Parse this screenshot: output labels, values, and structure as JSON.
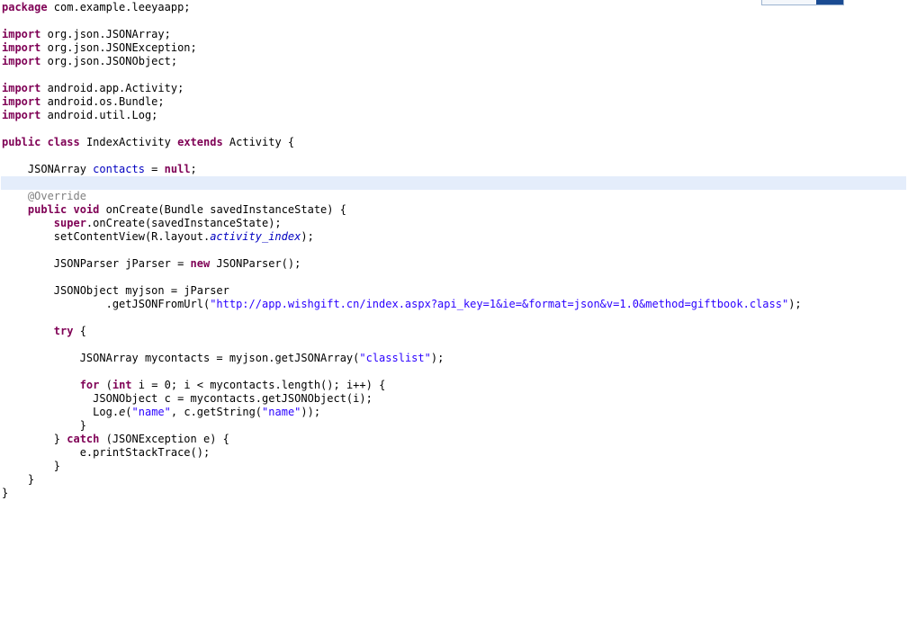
{
  "editor": {
    "language": "java",
    "font_size_px": 12,
    "line_height_px": 15,
    "highlight_line_index": 10,
    "colors": {
      "background": "#ffffff",
      "foreground": "#000000",
      "keyword": "#7f0055",
      "string": "#2a00ff",
      "field": "#0000c0",
      "annotation": "#808080",
      "current_line_highlight": "#e4edfb",
      "scrollbar_thumb": "#1a4b92"
    }
  },
  "scrollbar": {
    "name": "horizontal-scrollbar-fragment",
    "track_color": "#f4f7fb",
    "thumb_color": "#1a4b92"
  },
  "code": {
    "lines": [
      {
        "indent": 0,
        "tokens": [
          {
            "t": "kw",
            "v": "package"
          },
          {
            "t": "pln",
            "v": " com.example.leeyaapp;"
          }
        ]
      },
      {
        "indent": 0,
        "tokens": []
      },
      {
        "indent": 0,
        "tokens": [
          {
            "t": "kw",
            "v": "import"
          },
          {
            "t": "pln",
            "v": " org.json.JSONArray;"
          }
        ]
      },
      {
        "indent": 0,
        "tokens": [
          {
            "t": "kw",
            "v": "import"
          },
          {
            "t": "pln",
            "v": " org.json.JSONException;"
          }
        ]
      },
      {
        "indent": 0,
        "tokens": [
          {
            "t": "kw",
            "v": "import"
          },
          {
            "t": "pln",
            "v": " org.json.JSONObject;"
          }
        ]
      },
      {
        "indent": 0,
        "tokens": []
      },
      {
        "indent": 0,
        "tokens": [
          {
            "t": "kw",
            "v": "import"
          },
          {
            "t": "pln",
            "v": " android.app.Activity;"
          }
        ]
      },
      {
        "indent": 0,
        "tokens": [
          {
            "t": "kw",
            "v": "import"
          },
          {
            "t": "pln",
            "v": " android.os.Bundle;"
          }
        ]
      },
      {
        "indent": 0,
        "tokens": [
          {
            "t": "kw",
            "v": "import"
          },
          {
            "t": "pln",
            "v": " android.util.Log;"
          }
        ]
      },
      {
        "indent": 0,
        "tokens": []
      },
      {
        "indent": 0,
        "tokens": [
          {
            "t": "kw",
            "v": "public"
          },
          {
            "t": "pln",
            "v": " "
          },
          {
            "t": "kw",
            "v": "class"
          },
          {
            "t": "pln",
            "v": " IndexActivity "
          },
          {
            "t": "kw",
            "v": "extends"
          },
          {
            "t": "pln",
            "v": " Activity {"
          }
        ]
      },
      {
        "indent": 0,
        "tokens": []
      },
      {
        "indent": 4,
        "tokens": [
          {
            "t": "pln",
            "v": "JSONArray "
          },
          {
            "t": "fld",
            "v": "contacts"
          },
          {
            "t": "pln",
            "v": " = "
          },
          {
            "t": "kw",
            "v": "null"
          },
          {
            "t": "pln",
            "v": ";"
          }
        ]
      },
      {
        "indent": 0,
        "tokens": [],
        "highlight": true
      },
      {
        "indent": 4,
        "tokens": [
          {
            "t": "ann",
            "v": "@Override"
          }
        ]
      },
      {
        "indent": 4,
        "tokens": [
          {
            "t": "kw",
            "v": "public"
          },
          {
            "t": "pln",
            "v": " "
          },
          {
            "t": "kw",
            "v": "void"
          },
          {
            "t": "pln",
            "v": " onCreate(Bundle savedInstanceState) {"
          }
        ]
      },
      {
        "indent": 8,
        "tokens": [
          {
            "t": "kw",
            "v": "super"
          },
          {
            "t": "pln",
            "v": ".onCreate(savedInstanceState);"
          }
        ]
      },
      {
        "indent": 8,
        "tokens": [
          {
            "t": "pln",
            "v": "setContentView(R.layout."
          },
          {
            "t": "sfld",
            "v": "activity_index"
          },
          {
            "t": "pln",
            "v": ");"
          }
        ]
      },
      {
        "indent": 0,
        "tokens": []
      },
      {
        "indent": 8,
        "tokens": [
          {
            "t": "pln",
            "v": "JSONParser jParser = "
          },
          {
            "t": "kw",
            "v": "new"
          },
          {
            "t": "pln",
            "v": " JSONParser();"
          }
        ]
      },
      {
        "indent": 0,
        "tokens": []
      },
      {
        "indent": 8,
        "tokens": [
          {
            "t": "pln",
            "v": "JSONObject myjson = jParser"
          }
        ]
      },
      {
        "indent": 16,
        "tokens": [
          {
            "t": "pln",
            "v": ".getJSONFromUrl("
          },
          {
            "t": "str",
            "v": "\"http://app.wishgift.cn/index.aspx?api_key=1&ie=&format=json&v=1.0&method=giftbook.class\""
          },
          {
            "t": "pln",
            "v": ");"
          }
        ]
      },
      {
        "indent": 0,
        "tokens": []
      },
      {
        "indent": 8,
        "tokens": [
          {
            "t": "kw",
            "v": "try"
          },
          {
            "t": "pln",
            "v": " {"
          }
        ]
      },
      {
        "indent": 0,
        "tokens": []
      },
      {
        "indent": 12,
        "tokens": [
          {
            "t": "pln",
            "v": "JSONArray mycontacts = myjson.getJSONArray("
          },
          {
            "t": "str",
            "v": "\"classlist\""
          },
          {
            "t": "pln",
            "v": ");"
          }
        ]
      },
      {
        "indent": 0,
        "tokens": []
      },
      {
        "indent": 12,
        "tokens": [
          {
            "t": "kw",
            "v": "for"
          },
          {
            "t": "pln",
            "v": " ("
          },
          {
            "t": "kw",
            "v": "int"
          },
          {
            "t": "pln",
            "v": " i = 0; i < mycontacts.length(); i++) {"
          }
        ]
      },
      {
        "indent": 14,
        "tokens": [
          {
            "t": "pln",
            "v": "JSONObject c = mycontacts.getJSONObject(i);"
          }
        ]
      },
      {
        "indent": 14,
        "tokens": [
          {
            "t": "pln",
            "v": "Log."
          },
          {
            "t": "smtd",
            "v": "e"
          },
          {
            "t": "pln",
            "v": "("
          },
          {
            "t": "str",
            "v": "\"name\""
          },
          {
            "t": "pln",
            "v": ", c.getString("
          },
          {
            "t": "str",
            "v": "\"name\""
          },
          {
            "t": "pln",
            "v": "));"
          }
        ]
      },
      {
        "indent": 12,
        "tokens": [
          {
            "t": "pln",
            "v": "}"
          }
        ]
      },
      {
        "indent": 8,
        "tokens": [
          {
            "t": "pln",
            "v": "} "
          },
          {
            "t": "kw",
            "v": "catch"
          },
          {
            "t": "pln",
            "v": " (JSONException e) {"
          }
        ]
      },
      {
        "indent": 12,
        "tokens": [
          {
            "t": "pln",
            "v": "e.printStackTrace();"
          }
        ]
      },
      {
        "indent": 8,
        "tokens": [
          {
            "t": "pln",
            "v": "}"
          }
        ]
      },
      {
        "indent": 4,
        "tokens": [
          {
            "t": "pln",
            "v": "}"
          }
        ]
      },
      {
        "indent": 0,
        "tokens": [
          {
            "t": "pln",
            "v": "}"
          }
        ]
      }
    ]
  }
}
